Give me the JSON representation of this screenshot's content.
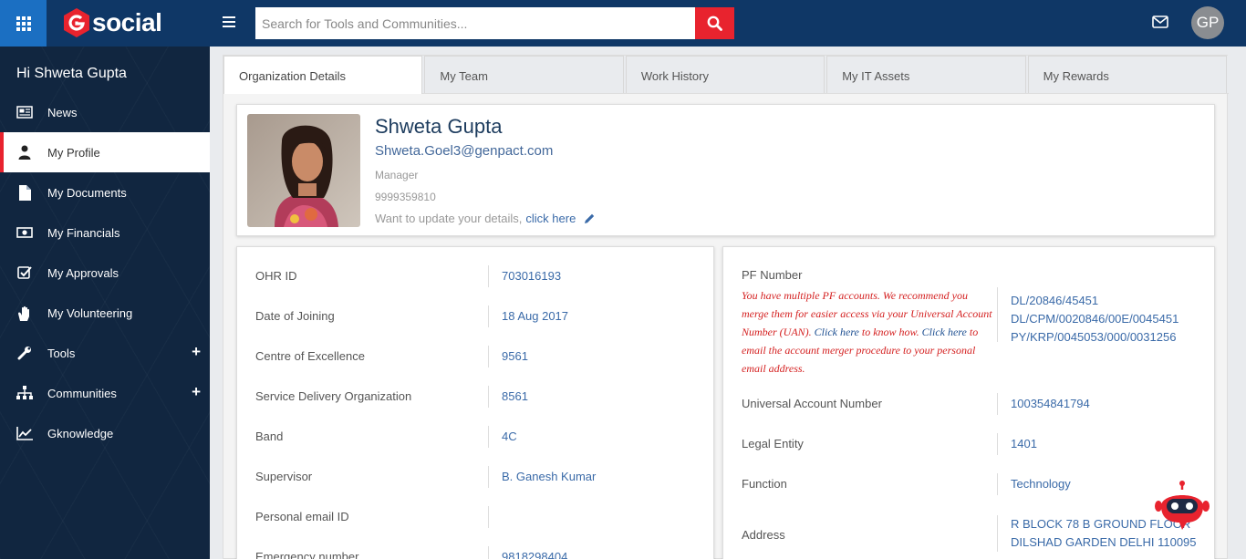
{
  "header": {
    "logo_text": "social",
    "search_placeholder": "Search for Tools and Communities...",
    "user_initials": "GP"
  },
  "sidebar": {
    "greeting": "Hi Shweta Gupta",
    "items": [
      {
        "label": "News",
        "icon": "newspaper-icon"
      },
      {
        "label": "My Profile",
        "icon": "user-icon",
        "active": true
      },
      {
        "label": "My Documents",
        "icon": "document-icon"
      },
      {
        "label": "My Financials",
        "icon": "money-icon"
      },
      {
        "label": "My Approvals",
        "icon": "checkbox-icon"
      },
      {
        "label": "My Volunteering",
        "icon": "hand-icon"
      },
      {
        "label": "Tools",
        "icon": "wrench-icon",
        "expandable": true
      },
      {
        "label": "Communities",
        "icon": "sitemap-icon",
        "expandable": true
      },
      {
        "label": "Gknowledge",
        "icon": "chart-icon"
      }
    ]
  },
  "tabs": [
    "Organization Details",
    "My Team",
    "Work History",
    "My IT Assets",
    "My Rewards"
  ],
  "profile": {
    "name": "Shweta Gupta",
    "email": "Shweta.Goel3@genpact.com",
    "role": "Manager",
    "phone": "9999359810",
    "update_text": "Want to update your details,",
    "update_link": "click here"
  },
  "org_details": [
    {
      "label": "OHR ID",
      "value": "703016193"
    },
    {
      "label": "Date of Joining",
      "value": "18 Aug 2017"
    },
    {
      "label": "Centre of Excellence",
      "value": "9561"
    },
    {
      "label": "Service Delivery Organization",
      "value": "8561"
    },
    {
      "label": "Band",
      "value": "4C"
    },
    {
      "label": "Supervisor",
      "value": "B. Ganesh Kumar"
    },
    {
      "label": "Personal email ID",
      "value": ""
    },
    {
      "label": "Emergency number",
      "value": "9818298404"
    }
  ],
  "pf": {
    "label": "PF Number",
    "note_1": "You have multiple PF accounts. We recommend you merge them for easier access via your Universal Account Number (UAN).",
    "note_link_1": "Click here",
    "note_2": "to know how.",
    "note_link_2": "Click here",
    "note_3": "to email the account merger procedure to your personal email address.",
    "values": [
      "DL/20846/45451",
      "DL/CPM/0020846/00E/0045451",
      "PY/KRP/0045053/000/0031256"
    ]
  },
  "right_details": [
    {
      "label": "Universal Account Number",
      "value": "100354841794"
    },
    {
      "label": "Legal Entity",
      "value": "1401"
    },
    {
      "label": "Function",
      "value": "Technology"
    }
  ],
  "address": {
    "label": "Address",
    "line1": "R BLOCK 78 B GROUND FLOOR",
    "line2": "DILSHAD GARDEN DELHI 110095"
  },
  "colors": {
    "topbar": "#0f3766",
    "sidebar": "#112640",
    "accent_red": "#e8232e",
    "link_blue": "#3a6aa8"
  }
}
